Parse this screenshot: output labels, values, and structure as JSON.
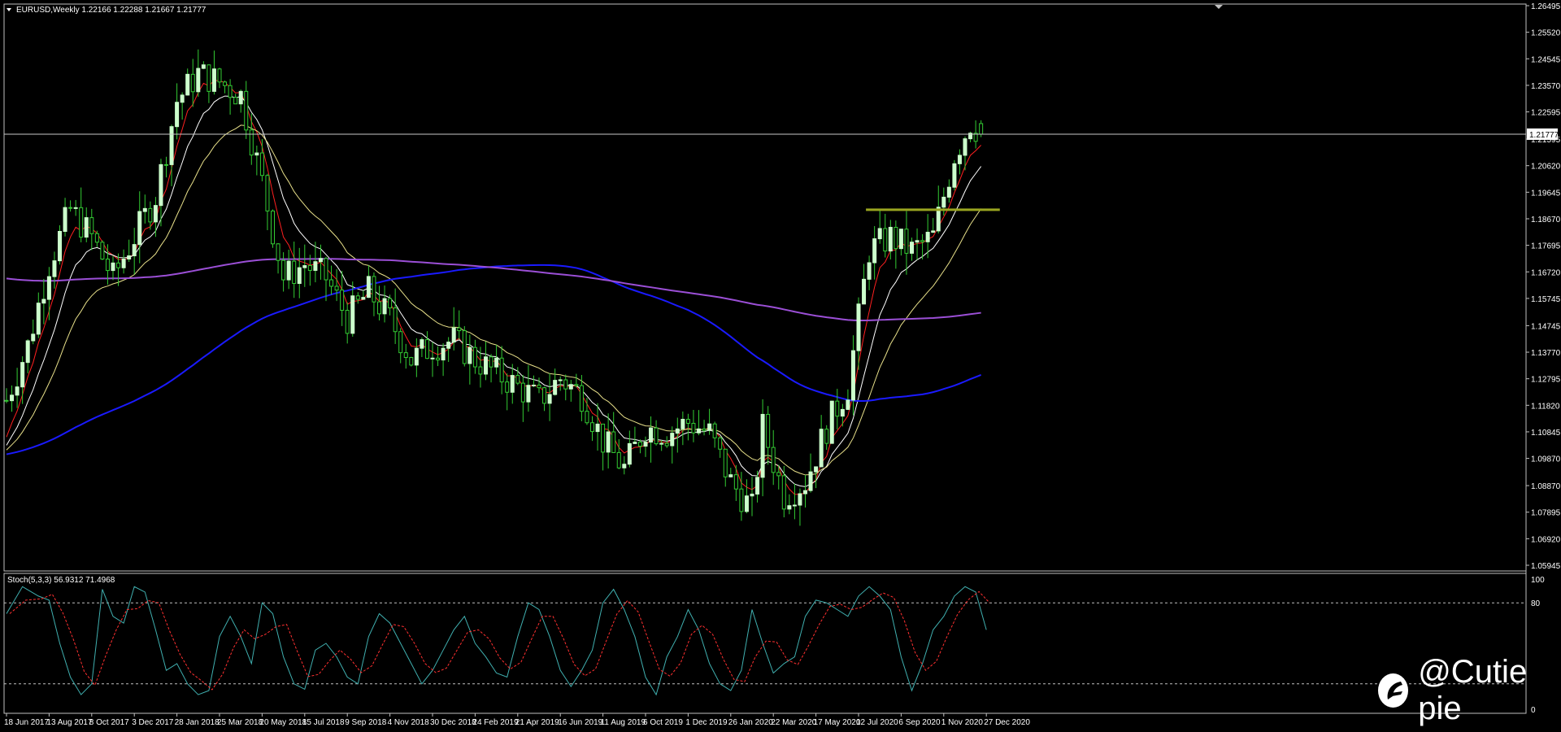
{
  "chart_data": [
    {
      "type": "candlestick",
      "title": "EURUSD,Weekly  1.22166 1.22288 1.21667 1.21777",
      "last_price_label": "1.21777",
      "ylim": [
        1.05945,
        1.26495
      ],
      "y_ticks": [
        "1.26495",
        "1.25520",
        "1.24545",
        "1.23570",
        "1.22595",
        "1.21595",
        "1.20620",
        "1.19645",
        "1.18670",
        "1.17695",
        "1.16720",
        "1.15745",
        "1.14745",
        "1.13770",
        "1.12795",
        "1.11820",
        "1.10845",
        "1.09870",
        "1.08870",
        "1.07895",
        "1.06920",
        "1.05945"
      ],
      "x_ticks": [
        "18 Jun 2017",
        "13 Aug 2017",
        "8 Oct 2017",
        "3 Dec 2017",
        "28 Jan 2018",
        "25 Mar 2018",
        "20 May 2018",
        "15 Jul 2018",
        "9 Sep 2018",
        "4 Nov 2018",
        "30 Dec 2018",
        "24 Feb 2019",
        "21 Apr 2019",
        "16 Jun 2019",
        "11 Aug 2019",
        "6 Oct 2019",
        "1 Dec 2019",
        "26 Jan 2020",
        "22 Mar 2020",
        "17 May 2020",
        "12 Jul 2020",
        "6 Sep 2020",
        "1 Nov 2020",
        "27 Dec 2020"
      ],
      "close_anchors": [
        [
          0,
          1.12
        ],
        [
          4,
          1.14
        ],
        [
          8,
          1.17
        ],
        [
          12,
          1.19
        ],
        [
          16,
          1.18
        ],
        [
          20,
          1.165
        ],
        [
          24,
          1.18
        ],
        [
          28,
          1.195
        ],
        [
          32,
          1.23
        ],
        [
          36,
          1.24
        ],
        [
          40,
          1.237
        ],
        [
          44,
          1.232
        ],
        [
          48,
          1.2
        ],
        [
          52,
          1.165
        ],
        [
          56,
          1.17
        ],
        [
          60,
          1.165
        ],
        [
          64,
          1.15
        ],
        [
          68,
          1.16
        ],
        [
          72,
          1.15
        ],
        [
          76,
          1.135
        ],
        [
          80,
          1.14
        ],
        [
          84,
          1.142
        ],
        [
          88,
          1.135
        ],
        [
          92,
          1.13
        ],
        [
          96,
          1.125
        ],
        [
          100,
          1.12
        ],
        [
          104,
          1.128
        ],
        [
          108,
          1.122
        ],
        [
          112,
          1.105
        ],
        [
          116,
          1.095
        ],
        [
          120,
          1.11
        ],
        [
          124,
          1.108
        ],
        [
          128,
          1.112
        ],
        [
          132,
          1.108
        ],
        [
          136,
          1.09
        ],
        [
          140,
          1.08
        ],
        [
          142,
          1.11
        ],
        [
          146,
          1.085
        ],
        [
          150,
          1.09
        ],
        [
          154,
          1.11
        ],
        [
          158,
          1.125
        ],
        [
          162,
          1.175
        ],
        [
          166,
          1.18
        ],
        [
          170,
          1.175
        ],
        [
          174,
          1.18
        ],
        [
          178,
          1.21
        ],
        [
          181,
          1.222
        ],
        [
          183,
          1.218
        ]
      ],
      "series": [
        {
          "name": "",
          "kind": "ema",
          "period": 5,
          "color": "#ff2020"
        },
        {
          "name": "",
          "kind": "ema",
          "period": 10,
          "color": "#ffffff"
        },
        {
          "name": "",
          "kind": "ema",
          "period": 20,
          "color": "#e8e08a"
        },
        {
          "name": "",
          "kind": "sma",
          "period": 100,
          "color": "#1a1aff"
        },
        {
          "name": "",
          "kind": "sma",
          "period": 200,
          "color": "#9b4fd6"
        }
      ],
      "annotations": [
        {
          "kind": "horizontal_line",
          "price": 1.21777,
          "color": "#c8c8c8"
        },
        {
          "kind": "horizontal_segment",
          "price": 1.19,
          "from_week": 162,
          "to_week": 185,
          "color": "#9aa520"
        }
      ],
      "bull_color": "#ccffcc",
      "bear_color": "#33cc33",
      "grid": false
    },
    {
      "type": "line",
      "title": "Stoch(5,3,3) 56.9312 71.4968",
      "ylim": [
        0,
        100
      ],
      "y_ticks": [
        "100",
        "80",
        "0"
      ],
      "levels": [
        80,
        20
      ],
      "stoch_anchors": [
        [
          0,
          72
        ],
        [
          3,
          92
        ],
        [
          6,
          85
        ],
        [
          8,
          82
        ],
        [
          10,
          50
        ],
        [
          12,
          25
        ],
        [
          14,
          12
        ],
        [
          16,
          20
        ],
        [
          18,
          90
        ],
        [
          20,
          70
        ],
        [
          22,
          65
        ],
        [
          24,
          92
        ],
        [
          26,
          88
        ],
        [
          28,
          60
        ],
        [
          30,
          30
        ],
        [
          32,
          35
        ],
        [
          34,
          20
        ],
        [
          36,
          12
        ],
        [
          38,
          15
        ],
        [
          40,
          55
        ],
        [
          42,
          70
        ],
        [
          44,
          55
        ],
        [
          46,
          35
        ],
        [
          48,
          80
        ],
        [
          50,
          72
        ],
        [
          52,
          40
        ],
        [
          54,
          20
        ],
        [
          56,
          16
        ],
        [
          58,
          45
        ],
        [
          60,
          50
        ],
        [
          62,
          40
        ],
        [
          64,
          25
        ],
        [
          66,
          20
        ],
        [
          68,
          55
        ],
        [
          70,
          72
        ],
        [
          72,
          65
        ],
        [
          74,
          50
        ],
        [
          76,
          35
        ],
        [
          78,
          20
        ],
        [
          80,
          30
        ],
        [
          82,
          45
        ],
        [
          84,
          60
        ],
        [
          86,
          70
        ],
        [
          88,
          50
        ],
        [
          90,
          40
        ],
        [
          92,
          28
        ],
        [
          94,
          25
        ],
        [
          96,
          55
        ],
        [
          98,
          80
        ],
        [
          100,
          75
        ],
        [
          102,
          55
        ],
        [
          104,
          30
        ],
        [
          106,
          18
        ],
        [
          108,
          30
        ],
        [
          110,
          45
        ],
        [
          112,
          80
        ],
        [
          114,
          90
        ],
        [
          116,
          75
        ],
        [
          118,
          55
        ],
        [
          120,
          25
        ],
        [
          122,
          12
        ],
        [
          124,
          40
        ],
        [
          126,
          55
        ],
        [
          128,
          75
        ],
        [
          130,
          60
        ],
        [
          132,
          35
        ],
        [
          134,
          20
        ],
        [
          136,
          15
        ],
        [
          138,
          30
        ],
        [
          140,
          75
        ],
        [
          142,
          50
        ],
        [
          144,
          28
        ],
        [
          146,
          35
        ],
        [
          148,
          40
        ],
        [
          150,
          70
        ],
        [
          152,
          82
        ],
        [
          154,
          80
        ],
        [
          156,
          75
        ],
        [
          158,
          70
        ],
        [
          160,
          85
        ],
        [
          162,
          92
        ],
        [
          164,
          85
        ],
        [
          166,
          75
        ],
        [
          168,
          40
        ],
        [
          170,
          15
        ],
        [
          172,
          35
        ],
        [
          174,
          60
        ],
        [
          176,
          70
        ],
        [
          178,
          85
        ],
        [
          180,
          92
        ],
        [
          182,
          88
        ],
        [
          184,
          60
        ]
      ],
      "series": [
        {
          "name": "",
          "kind": "main",
          "color": "#40b0b0"
        },
        {
          "name": "",
          "kind": "signal",
          "color": "#ff3030",
          "dashed": true
        }
      ]
    }
  ],
  "watermark": {
    "text": "@Cutie pie",
    "icon": "scissors-logo-icon"
  }
}
